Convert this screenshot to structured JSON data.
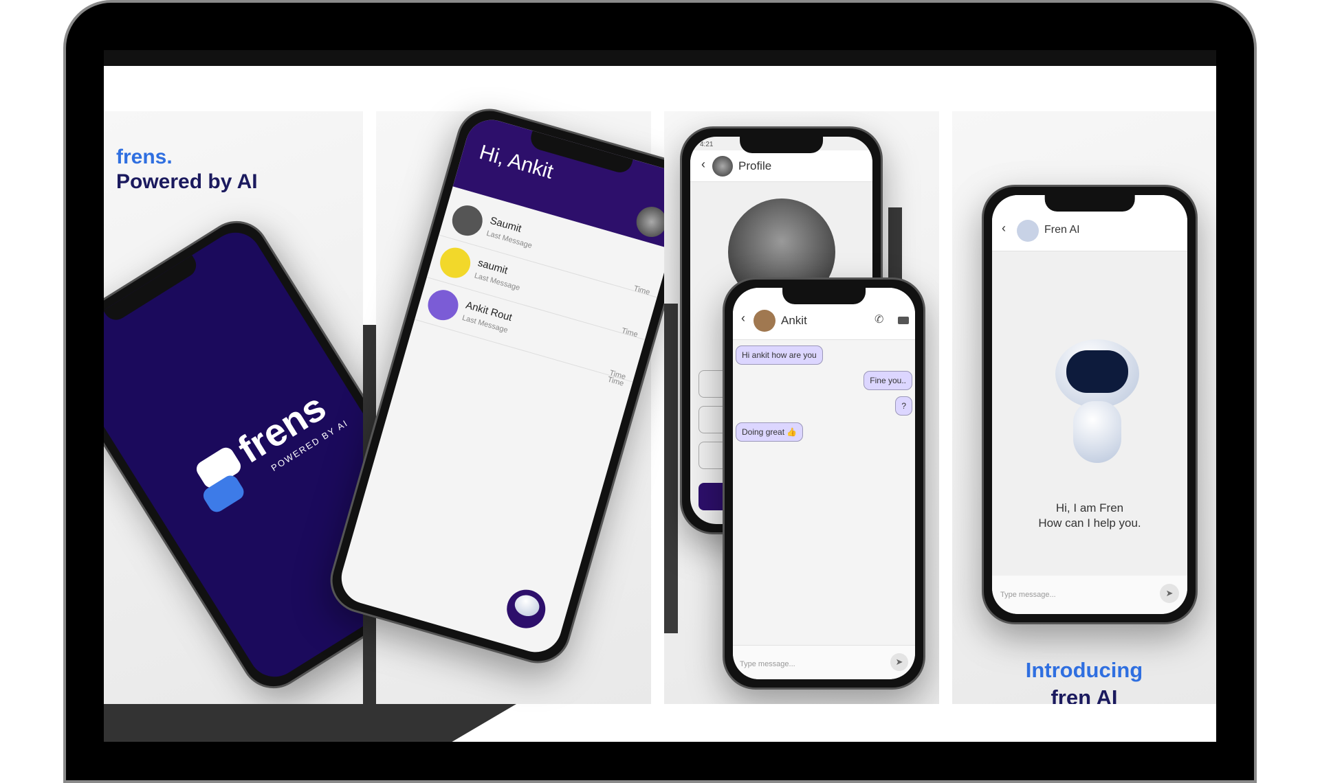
{
  "panel1": {
    "brand": "frens.",
    "tagline": "Powered by AI",
    "logo_text": "frens",
    "logo_sub": "POWERED BY AI",
    "screen_color": "#1b0a5c"
  },
  "panel2": {
    "greeting": "Hi, Ankit",
    "header_color": "#2d0f6b",
    "chats": [
      {
        "name": "Saumit",
        "last": "Last Message",
        "time": "Time"
      },
      {
        "name": "saumit",
        "last": "Last Message",
        "time": "Time"
      },
      {
        "name": "Ankit Rout",
        "last": "Last Message",
        "time": "Time"
      }
    ],
    "extra_time": "Time"
  },
  "panel3": {
    "profile_title": "Profile",
    "status_time": "4:21",
    "chat_name": "Ankit",
    "messages": [
      {
        "text": "Hi ankit how are you",
        "side": "left"
      },
      {
        "text": "Fine you..",
        "side": "right"
      },
      {
        "text": "?",
        "side": "right"
      },
      {
        "text": "Doing great 👍",
        "side": "left"
      }
    ],
    "input_placeholder": "Type message...",
    "bubble_color": "#dcd6ff"
  },
  "panel4": {
    "chat_name": "Fren AI",
    "greeting_line1": "Hi, I am Fren",
    "greeting_line2": "How can I help you.",
    "input_placeholder": "Type message...",
    "intro_line1": "Introducing",
    "intro_line2": "fren AI"
  },
  "colors": {
    "accent_blue": "#2f6fe0",
    "navy": "#1b1a5e",
    "purple": "#2d0f6b"
  }
}
